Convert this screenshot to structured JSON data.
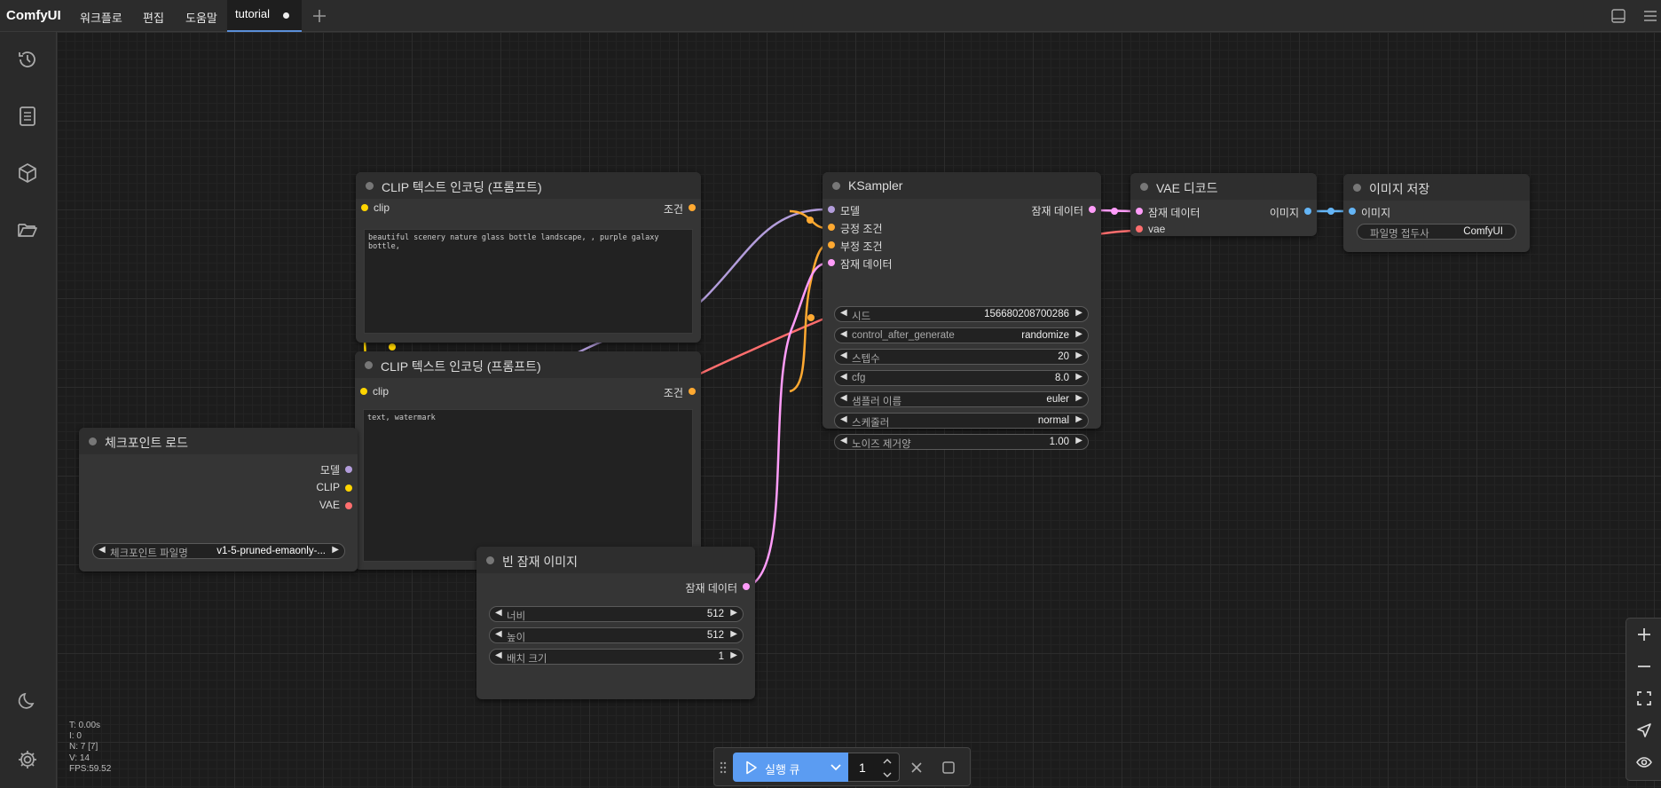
{
  "app": {
    "brand": "ComfyUI",
    "menu": [
      "워크플로",
      "편집",
      "도움말"
    ],
    "tab_title": "tutorial"
  },
  "sidebar": {
    "top_icons": [
      "history-icon",
      "document-icon",
      "cube-icon",
      "folder-open-icon"
    ],
    "bottom_icons": [
      "moon-icon",
      "gear-icon"
    ]
  },
  "nodes": {
    "clip_pos": {
      "title": "CLIP 텍스트 인코딩 (프롬프트)",
      "input": "clip",
      "output": "조건",
      "text": "beautiful scenery nature glass bottle landscape, , purple galaxy bottle,"
    },
    "clip_neg": {
      "title": "CLIP 텍스트 인코딩 (프롬프트)",
      "input": "clip",
      "output": "조건",
      "text": "text, watermark"
    },
    "checkpoint": {
      "title": "체크포인트 로드",
      "outputs": [
        "모델",
        "CLIP",
        "VAE"
      ],
      "widget_label": "체크포인트 파일명",
      "widget_value": "v1-5-pruned-emaonly-..."
    },
    "ksampler": {
      "title": "KSampler",
      "inputs": [
        "모델",
        "긍정 조건",
        "부정 조건",
        "잠재 데이터"
      ],
      "output": "잠재 데이터",
      "widgets": [
        {
          "label": "시드",
          "value": "156680208700286"
        },
        {
          "label": "control_after_generate",
          "value": "randomize"
        },
        {
          "label": "스텝수",
          "value": "20"
        },
        {
          "label": "cfg",
          "value": "8.0"
        },
        {
          "label": "샘플러 이름",
          "value": "euler"
        },
        {
          "label": "스케줄러",
          "value": "normal"
        },
        {
          "label": "노이즈 제거양",
          "value": "1.00"
        }
      ]
    },
    "vae_decode": {
      "title": "VAE 디코드",
      "inputs": [
        "잠재 데이터",
        "vae"
      ],
      "output": "이미지"
    },
    "save_image": {
      "title": "이미지 저장",
      "input": "이미지",
      "widget_label": "파일명 접두사",
      "widget_value": "ComfyUI"
    },
    "empty_latent": {
      "title": "빈 잠재 이미지",
      "output": "잠재 데이터",
      "widgets": [
        {
          "label": "너비",
          "value": "512"
        },
        {
          "label": "높이",
          "value": "512"
        },
        {
          "label": "배치 크기",
          "value": "1"
        }
      ]
    }
  },
  "stats": {
    "t": "T: 0.00s",
    "i": "I: 0",
    "n": "N: 7 [7]",
    "v": "V: 14",
    "fps": "FPS:59.52"
  },
  "runbar": {
    "label": "실행 큐",
    "quantity": "1"
  },
  "colors": {
    "clip": "#ffd500",
    "model": "#b39ddb",
    "conditioning": "#ffa931",
    "latent": "#ff9cf9",
    "vae": "#ff6e6e",
    "image": "#64b5f6",
    "accent": "#5b9cf2"
  }
}
